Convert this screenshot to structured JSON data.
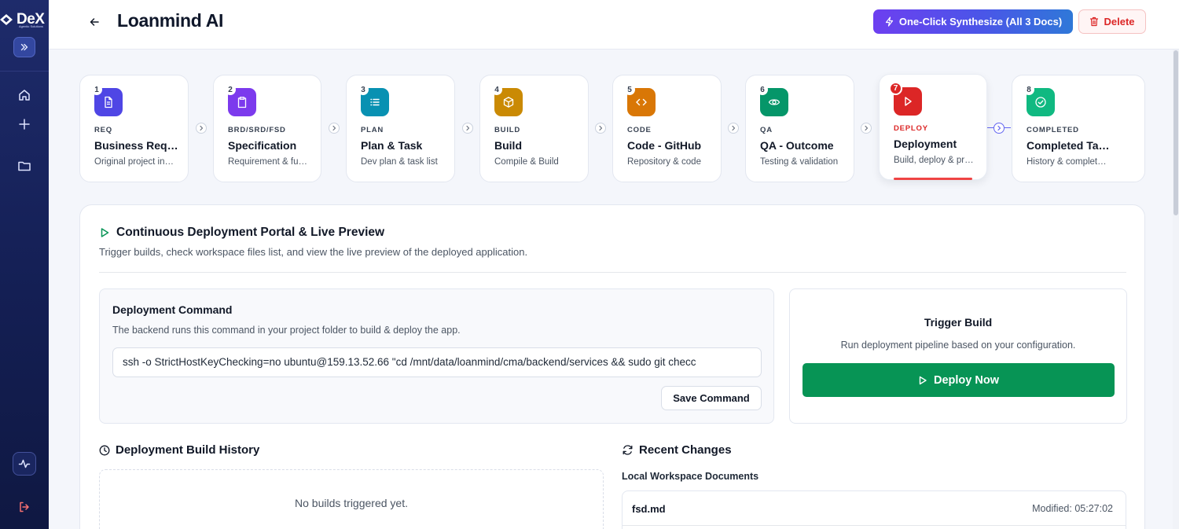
{
  "brand": {
    "name": "DeX",
    "tagline": "Agentic Solutions"
  },
  "header": {
    "title": "Loanmind AI",
    "synthesize_label": "One-Click Synthesize (All 3 Docs)",
    "delete_label": "Delete"
  },
  "sidebar": {
    "items": [
      {
        "icon": "home-icon"
      },
      {
        "icon": "plus-icon"
      },
      {
        "icon": "folder-icon"
      },
      {
        "icon": "activity-icon"
      },
      {
        "icon": "logout-icon"
      }
    ]
  },
  "steps": [
    {
      "num": "1",
      "tag": "REQ",
      "title": "Business Requirements",
      "sub": "Original project input",
      "color": "#4f46e5",
      "icon": "document-icon"
    },
    {
      "num": "2",
      "tag": "BRD/SRD/FSD",
      "title": "Specification",
      "sub": "Requirement & functional",
      "color": "#7c3aed",
      "icon": "clipboard-icon"
    },
    {
      "num": "3",
      "tag": "PLAN",
      "title": "Plan & Task",
      "sub": "Dev plan & task list",
      "color": "#0891b2",
      "icon": "list-icon"
    },
    {
      "num": "4",
      "tag": "BUILD",
      "title": "Build",
      "sub": "Compile & Build",
      "color": "#ca8a04",
      "icon": "box-icon"
    },
    {
      "num": "5",
      "tag": "CODE",
      "title": "Code - GitHub",
      "sub": "Repository & code",
      "color": "#d97706",
      "icon": "code-icon"
    },
    {
      "num": "6",
      "tag": "QA",
      "title": "QA - Outcome",
      "sub": "Testing & validation",
      "color": "#059669",
      "icon": "eye-icon"
    },
    {
      "num": "7",
      "tag": "DEPLOY",
      "title": "Deployment",
      "sub": "Build, deploy & preview",
      "color": "#dc2626",
      "icon": "play-icon"
    },
    {
      "num": "8",
      "tag": "COMPLETED",
      "title": "Completed Tasks",
      "sub": "History & completed items",
      "color": "#10b981",
      "icon": "check-circle-icon"
    }
  ],
  "portal": {
    "title": "Continuous Deployment Portal & Live Preview",
    "description": "Trigger builds, check workspace files list, and view the live preview of the deployed application."
  },
  "command": {
    "title": "Deployment Command",
    "description": "The backend runs this command in your project folder to build & deploy the app.",
    "value": "ssh -o StrictHostKeyChecking=no ubuntu@159.13.52.66 \"cd /mnt/data/loanmind/cma/backend/services && sudo git checc",
    "save_label": "Save Command"
  },
  "trigger": {
    "title": "Trigger Build",
    "description": "Run deployment pipeline based on your configuration.",
    "deploy_label": "Deploy Now"
  },
  "history": {
    "title": "Deployment Build History",
    "empty": "No builds triggered yet."
  },
  "changes": {
    "title": "Recent Changes",
    "subtitle": "Local Workspace Documents",
    "files": [
      {
        "name": "fsd.md",
        "modified": "Modified: 05:27:02"
      }
    ]
  }
}
